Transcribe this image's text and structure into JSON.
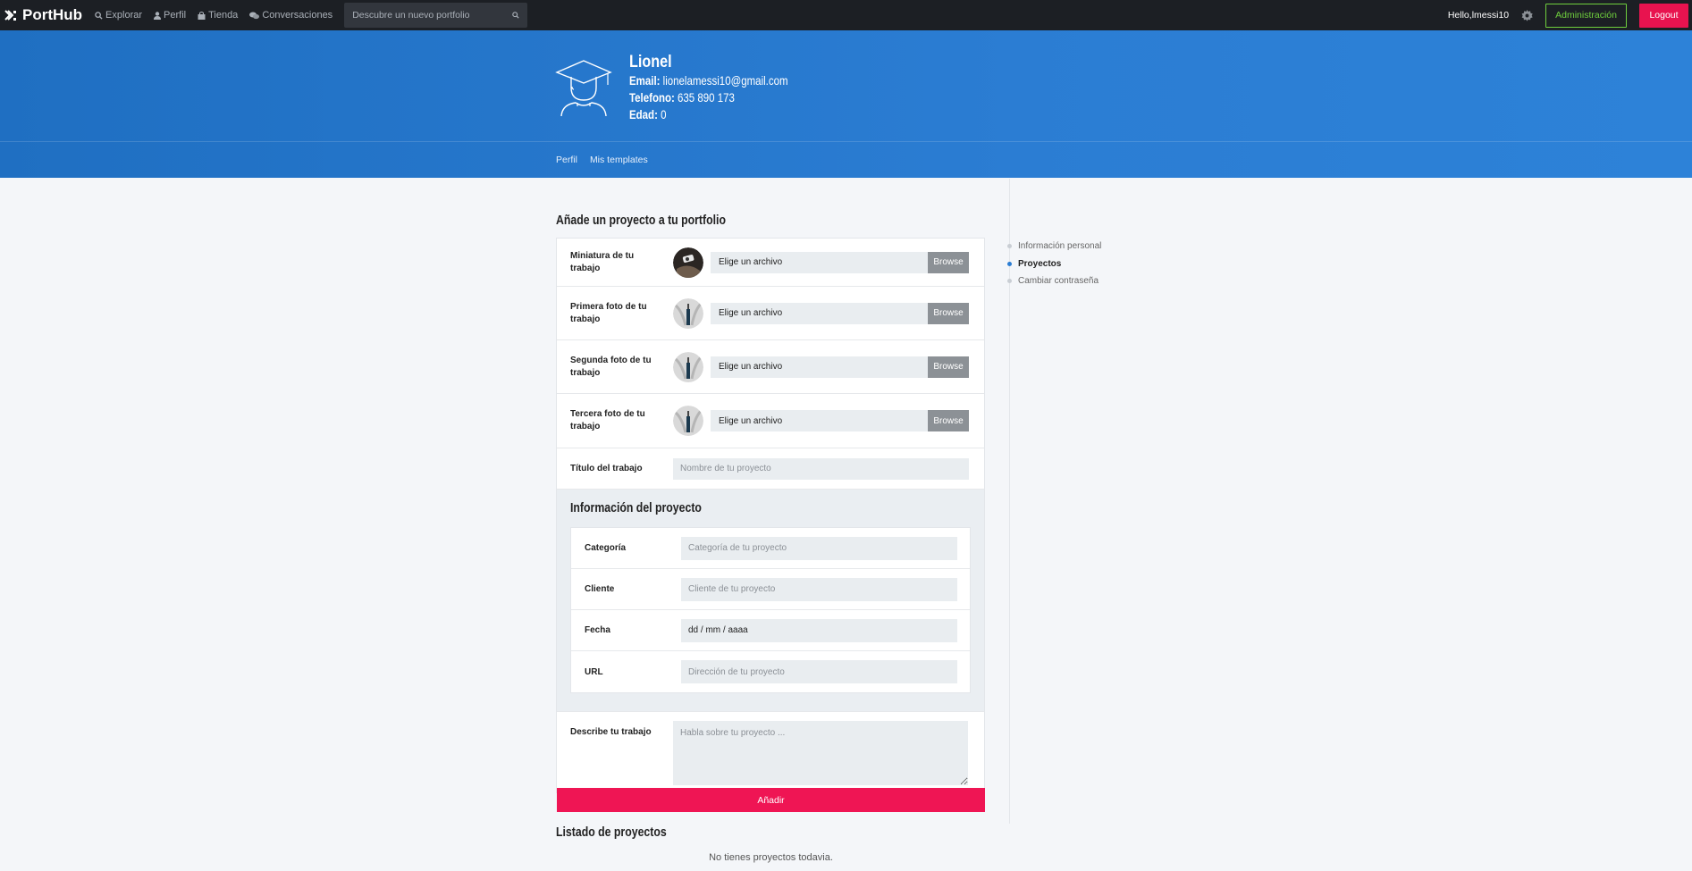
{
  "app": {
    "name": "PortHub"
  },
  "nav": {
    "items": [
      {
        "label": "Explorar",
        "icon": "search-icon"
      },
      {
        "label": "Perfil",
        "icon": "user-icon"
      },
      {
        "label": "Tienda",
        "icon": "shop-icon"
      },
      {
        "label": "Conversaciones",
        "icon": "chat-icon"
      }
    ],
    "search_placeholder": "Descubre un nuevo portfolio"
  },
  "user_bar": {
    "greeting": "Hello,lmessi10",
    "admin_label": "Administración",
    "logout_label": "Logout"
  },
  "profile": {
    "name": "Lionel",
    "email_label": "Email:",
    "email": "lionelamessi10@gmail.com",
    "phone_label": "Telefono:",
    "phone": "635 890 173",
    "age_label": "Edad:",
    "age": "0",
    "tabs": [
      "Perfil",
      "Mis templates"
    ]
  },
  "form": {
    "title": "Añade un proyecto a tu portfolio",
    "file_rows": [
      {
        "label": "Miniatura de tu trabajo",
        "file_text": "Elige un archivo",
        "browse": "Browse"
      },
      {
        "label": "Primera foto de tu trabajo",
        "file_text": "Elige un archivo",
        "browse": "Browse"
      },
      {
        "label": "Segunda foto de tu trabajo",
        "file_text": "Elige un archivo",
        "browse": "Browse"
      },
      {
        "label": "Tercera foto de tu trabajo",
        "file_text": "Elige un archivo",
        "browse": "Browse"
      }
    ],
    "title_field": {
      "label": "Título del trabajo",
      "placeholder": "Nombre de tu proyecto"
    },
    "info": {
      "title": "Información del proyecto",
      "fields": [
        {
          "label": "Categoría",
          "placeholder": "Categoría de tu proyecto"
        },
        {
          "label": "Cliente",
          "placeholder": "Cliente de tu proyecto"
        },
        {
          "label": "Fecha",
          "value": "dd / mm / aaaa"
        },
        {
          "label": "URL",
          "placeholder": "Dirección de tu proyecto"
        }
      ]
    },
    "description": {
      "label": "Describe tu trabajo",
      "placeholder": "Habla sobre tu proyecto ..."
    },
    "submit_label": "Añadir"
  },
  "projects": {
    "title": "Listado de proyectos",
    "empty": "No tienes proyectos todavia."
  },
  "sidebar": {
    "items": [
      {
        "label": "Información personal",
        "active": false
      },
      {
        "label": "Proyectos",
        "active": true
      },
      {
        "label": "Cambiar contraseña",
        "active": false
      }
    ]
  },
  "colors": {
    "accent": "#2b7dd3",
    "danger": "#ef1554",
    "admin": "#6fcf3d",
    "topbar": "#1c1f24"
  }
}
